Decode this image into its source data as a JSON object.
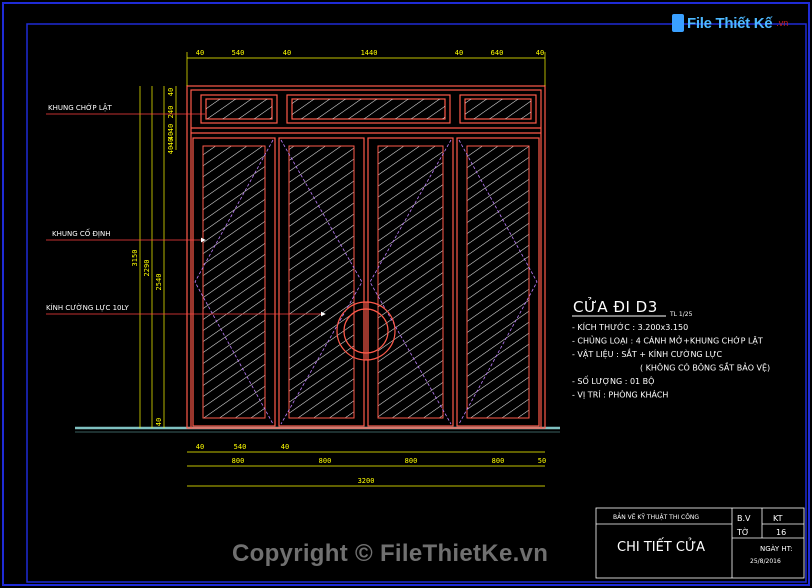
{
  "logo": {
    "text": "File Thiết Kế",
    "suffix": ".vn"
  },
  "labels": {
    "khung_chop_lat": "KHUNG CHỚP LẬT",
    "khung_co_dinh": "KHUNG CỐ ĐỊNH",
    "kinh": "KÍNH CƯỜNG LỰC 10LY"
  },
  "dims": {
    "top": [
      "40",
      "540",
      "40",
      "1440",
      "40",
      "640",
      "40"
    ],
    "bottom_row1": [
      "40",
      "540",
      "40"
    ],
    "bottom_row2": [
      "800",
      "800",
      "800",
      "800",
      "50"
    ],
    "total": "3200",
    "left_small": [
      "40",
      "240",
      "40",
      "40",
      "40",
      "40"
    ],
    "left_big": [
      "3150",
      "2290",
      "2540",
      "40"
    ]
  },
  "spec": {
    "title": "CỬA ĐI D3",
    "scale": "TL 1/25",
    "lines": [
      "- KÍCH THƯỚC : 3.200x3.150",
      "- CHỦNG LOẠI : 4 CÁNH MỞ+KHUNG CHỚP LẬT",
      "- VẬT LIỆU      : SẮT + KÍNH CƯỜNG LỰC",
      "( KHÔNG CÓ BÔNG SẮT BẢO VỆ)",
      "- SỐ LƯỢNG     : 01 BỘ",
      "- VỊ TRÍ          : PHÒNG KHÁCH"
    ]
  },
  "title_block": {
    "header": "BẢN VẼ KỸ THUẬT THI CÔNG",
    "name": "CHI TIẾT CỬA",
    "bv_label": "B.V",
    "bv_value": "KT",
    "to_label": "TỜ",
    "to_value": "16",
    "date_label": "NGÀY HT:",
    "date_value": "25/8/2016"
  },
  "watermark": "Copyright © FileThietKe.vn",
  "colors": {
    "frame": "#1f2bd6",
    "door": "#ff5a4a",
    "hatch": "#e6e6e6",
    "dim": "#ffff00",
    "label_line": "#ff4040",
    "swing": "#c080ff"
  }
}
